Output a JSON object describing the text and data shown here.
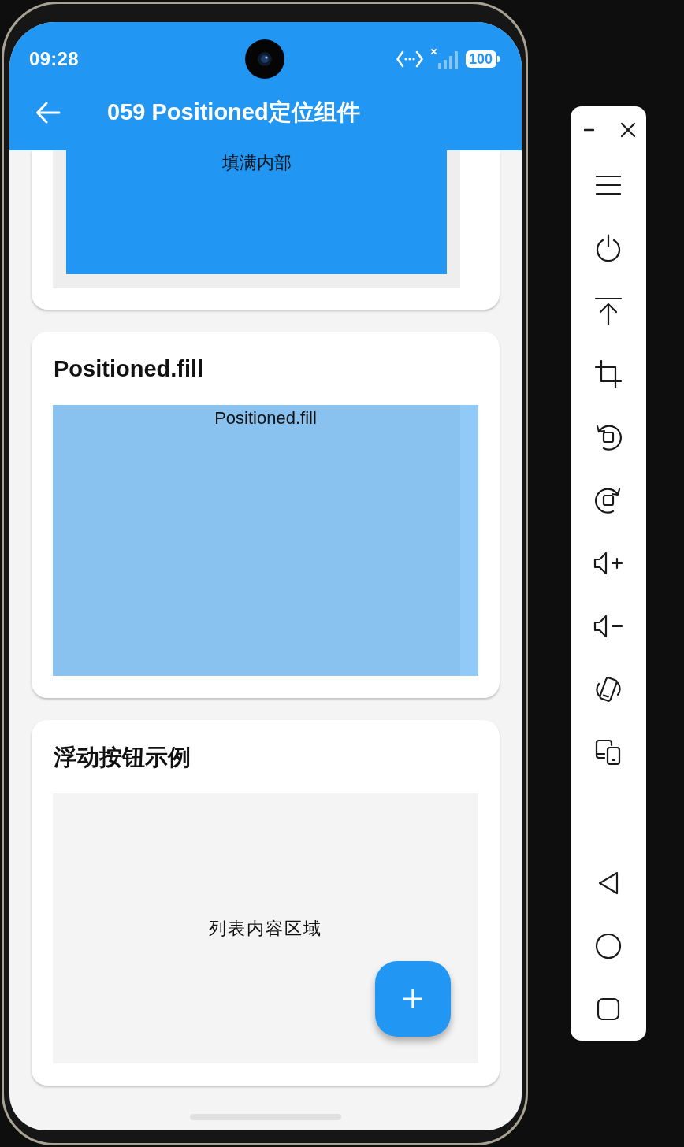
{
  "status_bar": {
    "time": "09:28",
    "battery": "100"
  },
  "app_bar": {
    "title": "059 Positioned定位组件"
  },
  "sections": [
    {
      "kind": "fill_inside",
      "label": "填满内部"
    },
    {
      "kind": "positioned_fill",
      "title": "Positioned.fill",
      "label": "Positioned.fill"
    },
    {
      "kind": "floating_button",
      "title": "浮动按钮示例",
      "label": "列表内容区域"
    }
  ]
}
